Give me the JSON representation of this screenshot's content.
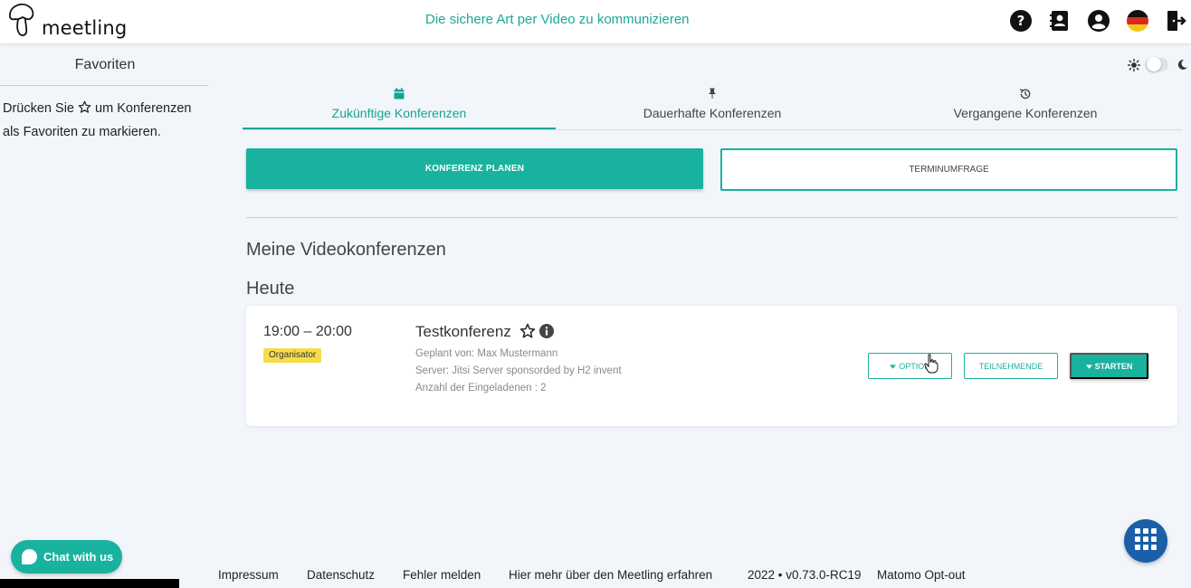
{
  "header": {
    "logo_text": "meetling",
    "tagline": "Die sichere Art per Video zu kommunizieren",
    "icons": [
      "help-icon",
      "contacts-icon",
      "account-icon",
      "german-flag-icon",
      "logout-icon"
    ]
  },
  "sidebar": {
    "title": "Favoriten",
    "hint_part1": "Drücken Sie",
    "hint_part2": "um Konferenzen als Favoriten zu markieren."
  },
  "tabs": [
    {
      "label": "Zukünftige Konferenzen",
      "icon": "calendar-icon",
      "active": true
    },
    {
      "label": "Dauerhafte Konferenzen",
      "icon": "pin-icon",
      "active": false
    },
    {
      "label": "Vergangene Konferenzen",
      "icon": "history-icon",
      "active": false
    }
  ],
  "actions": {
    "plan_label": "KONFERENZ PLANEN",
    "poll_label": "TERMINUMFRAGE"
  },
  "sections": {
    "my_conferences": "Meine Videokonferenzen",
    "today": "Heute"
  },
  "conference": {
    "time": "19:00 – 20:00",
    "badge": "Organisator",
    "title": "Testkonferenz",
    "planned_by": "Geplant von: Max Mustermann",
    "server": "Server: Jitsi Server sponsorded by H2 invent",
    "invited": "Anzahl der Eingeladenen : 2",
    "options_label": "OPTION",
    "participants_label": "TEILNEHMENDE",
    "start_label": "STARTEN"
  },
  "chat": {
    "label": "Chat with us"
  },
  "footer": {
    "impressum": "Impressum",
    "datenschutz": "Datenschutz",
    "fehler": "Fehler melden",
    "mehr": "Hier mehr über den Meetling erfahren",
    "version": "2022 • v0.73.0-RC19",
    "matomo": "Matomo Opt-out"
  },
  "colors": {
    "accent": "#19b29f",
    "badge": "#f7dc4a",
    "fab": "#1a5fa8"
  }
}
